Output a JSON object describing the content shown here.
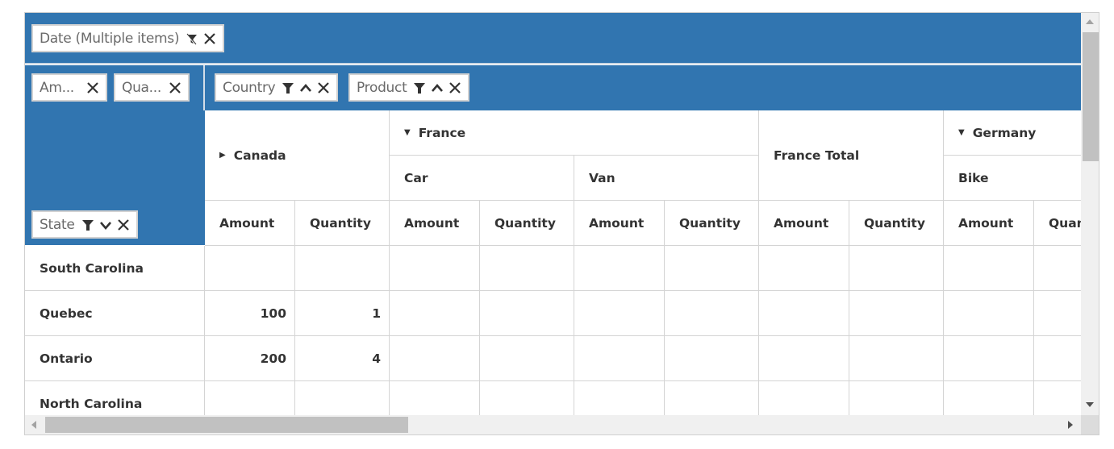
{
  "colors": {
    "header_blue": "#3175b0",
    "chip_border": "#d2d2d2",
    "grid_line": "#d4d4d4",
    "scrollbar_track": "#f0f0f0",
    "scrollbar_thumb": "#c1c1c1"
  },
  "filter_area": {
    "chips": [
      {
        "label": "Date (Multiple items)",
        "icons": [
          "filtered-funnel-icon",
          "close-icon"
        ]
      }
    ]
  },
  "values_area": {
    "chips": [
      {
        "label": "Am...",
        "icons": [
          "close-icon"
        ]
      },
      {
        "label": "Qua...",
        "icons": [
          "close-icon"
        ]
      }
    ]
  },
  "columns_area": {
    "chips": [
      {
        "label": "Country",
        "icons": [
          "funnel-icon",
          "sort-ascending-icon",
          "close-icon"
        ]
      },
      {
        "label": "Product",
        "icons": [
          "funnel-icon",
          "sort-ascending-icon",
          "close-icon"
        ]
      }
    ]
  },
  "rows_area": {
    "chips": [
      {
        "label": "State",
        "icons": [
          "funnel-icon",
          "sort-descending-icon",
          "close-icon"
        ]
      }
    ]
  },
  "column_headers": {
    "level1": [
      {
        "label": "Canada",
        "expanded": false
      },
      {
        "label": "France",
        "expanded": true
      },
      {
        "label": "France Total"
      },
      {
        "label": "Germany",
        "expanded": true
      }
    ],
    "level2": [
      "Car",
      "Van",
      "Bike"
    ],
    "measures": [
      "Amount",
      "Quantity",
      "Amount",
      "Quantity",
      "Amount",
      "Quantity",
      "Amount",
      "Quantity",
      "Amount",
      "Quantity"
    ]
  },
  "rows": [
    {
      "label": "South Carolina",
      "values": [
        "",
        "",
        "",
        "",
        "",
        "",
        "",
        "",
        "",
        ""
      ]
    },
    {
      "label": "Quebec",
      "values": [
        "100",
        "1",
        "",
        "",
        "",
        "",
        "",
        "",
        "",
        ""
      ]
    },
    {
      "label": "Ontario",
      "values": [
        "200",
        "4",
        "",
        "",
        "",
        "",
        "",
        "",
        "",
        ""
      ]
    },
    {
      "label": "North Carolina",
      "values": [
        "",
        "",
        "",
        "",
        "",
        "",
        "",
        "",
        "",
        ""
      ]
    }
  ]
}
